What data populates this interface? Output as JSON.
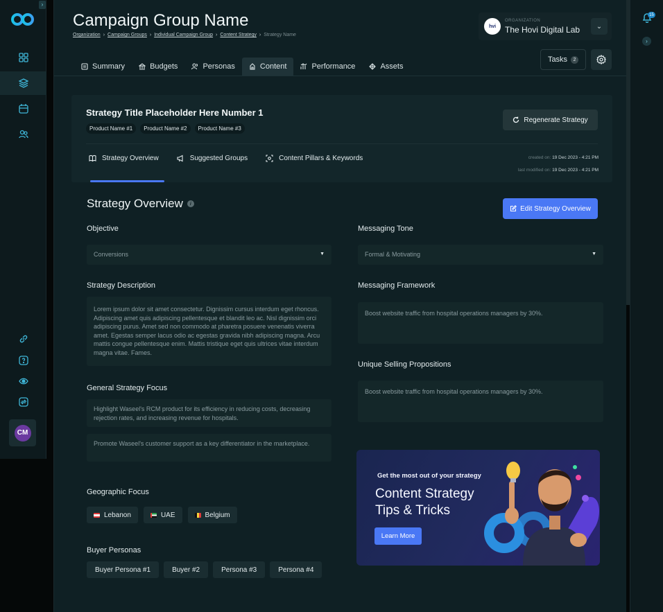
{
  "header": {
    "page_title": "Campaign Group Name",
    "breadcrumb": [
      "Organization",
      "Campaign Groups",
      "Individual Campaign Group",
      "Content Strategy",
      "Strategy Name"
    ],
    "org_label": "ORGANIZATION",
    "org_name": "The Hovi Digital Lab",
    "org_logo_text": "hvi",
    "tasks_label": "Tasks",
    "tasks_count": "2"
  },
  "tabs": [
    "Summary",
    "Budgets",
    "Personas",
    "Content",
    "Performance",
    "Assets"
  ],
  "active_tab": "Content",
  "strategy": {
    "title": "Strategy Title Placeholder Here Number 1",
    "products": [
      "Product Name #1",
      "Product Name #2",
      "Product Name #3"
    ],
    "regenerate_label": "Regenerate Strategy",
    "subtabs": [
      "Strategy Overview",
      "Suggested Groups",
      "Content Pillars & Keywords"
    ],
    "created_label": "created on:",
    "created_value": "19 Dec 2023 - 4:21 PM",
    "modified_label": "last modified on:",
    "modified_value": "19 Dec 2023 - 4:21 PM"
  },
  "overview": {
    "title": "Strategy Overview",
    "edit_label": "Edit Strategy Overview",
    "objective_label": "Objective",
    "objective_value": "Conversions",
    "tone_label": "Messaging Tone",
    "tone_value": "Formal & Motivating",
    "description_label": "Strategy Description",
    "description_value": "Lorem ipsum dolor sit amet consectetur. Dignissim cursus interdum eget rhoncus. Adipiscing amet quis adipiscing pellentesque et blandit leo ac. Nisl dignissim orci adipiscing purus. Amet sed non commodo at pharetra posuere venenatis viverra amet. Egestas semper lacus odio ac egestas gravida nibh adipiscing magna. Arcu mattis congue pellentesque enim. Mattis tristique eget quis ultrices vitae interdum magna vitae. Fames.",
    "framework_label": "Messaging Framework",
    "framework_value": "Boost website traffic from hospital operations managers by 30%.",
    "usp_label": "Unique Selling Propositions",
    "usp_value": "Boost website traffic from hospital operations managers by 30%.",
    "focus_label": "General Strategy Focus",
    "focus_items": [
      "Highlight Waseel's RCM product for its efficiency in reducing costs, decreasing rejection rates, and increasing revenue for hospitals.",
      "Promote Waseel's customer support as a key differentiator in the marketplace."
    ],
    "geo_label": "Geographic Focus",
    "geo": [
      "Lebanon",
      "UAE",
      "Belgium"
    ],
    "personas_label": "Buyer Personas",
    "personas": [
      "Buyer Persona #1",
      "Buyer #2",
      "Persona #3",
      "Persona #4"
    ]
  },
  "promo": {
    "kicker": "Get the most out of your strategy",
    "headline_line1": "Content Strategy",
    "headline_line2": "Tips & Tricks",
    "cta": "Learn More"
  },
  "sidebar": {
    "avatar_initials": "CM"
  },
  "notifications": {
    "count": "15"
  },
  "colors": {
    "accent": "#4a78f5",
    "brand": "#1fb6d8"
  }
}
